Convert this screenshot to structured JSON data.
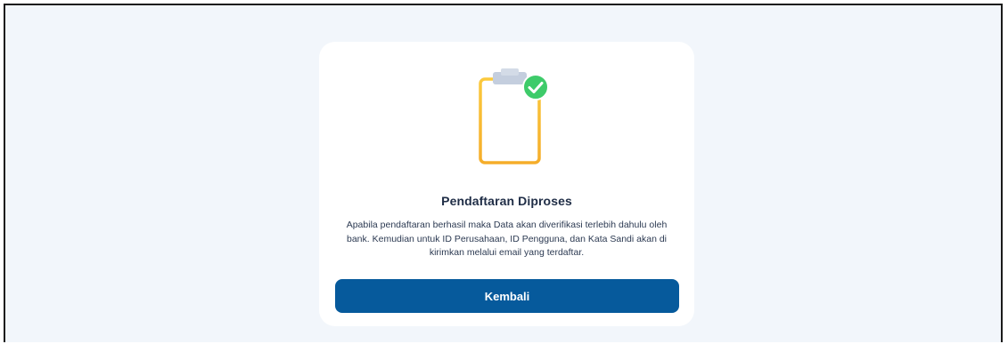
{
  "dialog": {
    "title": "Pendaftaran Diproses",
    "message": "Apabila pendaftaran berhasil maka Data akan diverifikasi terlebih dahulu oleh bank. Kemudian untuk ID Perusahaan, ID Pengguna, dan Kata Sandi akan di kirimkan melalui email yang terdaftar.",
    "button_label": "Kembali"
  },
  "icons": {
    "illustration": "clipboard-check-icon"
  },
  "colors": {
    "page_background": "#f2f6fb",
    "card_background": "#ffffff",
    "primary_button": "#065a9c",
    "clipboard_outline": "#f7b731",
    "check_badge": "#3ecb6a",
    "title_text": "#1f2d46"
  }
}
